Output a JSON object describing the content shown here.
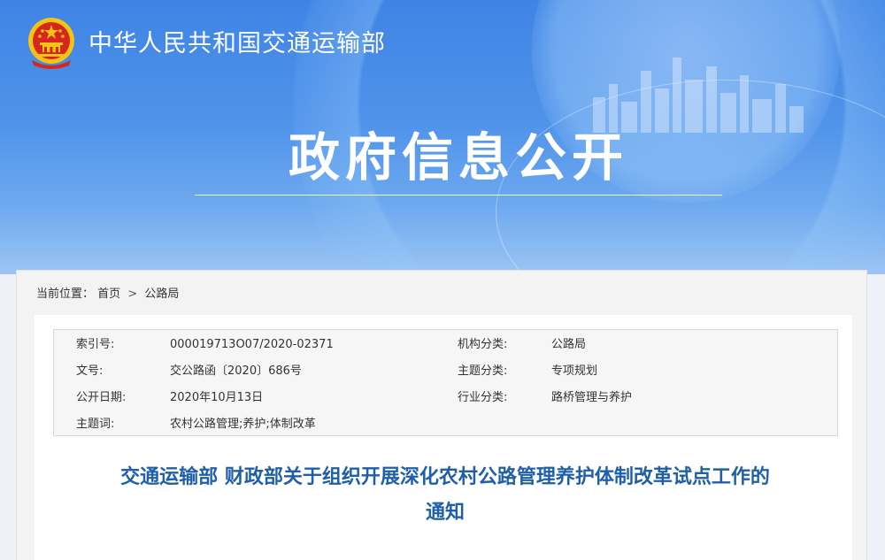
{
  "header": {
    "site_name": "中华人民共和国交通运输部",
    "banner_title": "政府信息公开",
    "emblem_icon": "national-emblem-icon",
    "colors": {
      "banner": "#3f84e5",
      "title_blue": "#1f5fa8",
      "emblem_red": "#d7261e",
      "emblem_gold": "#f3c316"
    }
  },
  "breadcrumb": {
    "label": "当前位置：",
    "items": [
      "首页",
      "公路局"
    ],
    "separator": ">"
  },
  "meta": {
    "rows": [
      {
        "label1": "索引号:",
        "value1": "000019713O07/2020-02371",
        "label2": "机构分类:",
        "value2": "公路局"
      },
      {
        "label1": "文号:",
        "value1": "交公路函〔2020〕686号",
        "label2": "主题分类:",
        "value2": "专项规划"
      },
      {
        "label1": "公开日期:",
        "value1": "2020年10月13日",
        "label2": "行业分类:",
        "value2": "路桥管理与养护"
      },
      {
        "label1": "主题词:",
        "value1": "农村公路管理;养护;体制改革",
        "label2": "",
        "value2": ""
      }
    ]
  },
  "document": {
    "title_line1": "交通运输部 财政部关于组织开展深化农村公路管理养护体制改革试点工作的",
    "title_line2": "通知"
  }
}
